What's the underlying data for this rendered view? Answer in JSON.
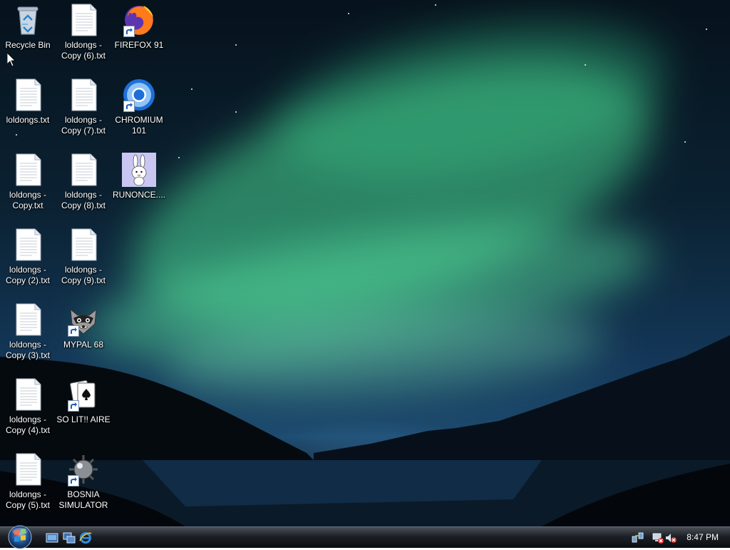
{
  "desktop": {
    "icons": [
      {
        "label": "Recycle Bin",
        "icon": "recycle-bin-icon"
      },
      {
        "label": "loldongs - Copy (6).txt",
        "icon": "text-file-icon"
      },
      {
        "label": "FIREFOX 91",
        "icon": "firefox-icon"
      },
      {
        "label": "loldongs.txt",
        "icon": "text-file-icon"
      },
      {
        "label": "loldongs - Copy (7).txt",
        "icon": "text-file-icon"
      },
      {
        "label": "CHROMIUM 101",
        "icon": "chromium-icon"
      },
      {
        "label": "loldongs - Copy.txt",
        "icon": "text-file-icon"
      },
      {
        "label": "loldongs - Copy (8).txt",
        "icon": "text-file-icon"
      },
      {
        "label": "RUNONCE....",
        "icon": "bunny-icon"
      },
      {
        "label": "loldongs - Copy (2).txt",
        "icon": "text-file-icon"
      },
      {
        "label": "loldongs - Copy (9).txt",
        "icon": "text-file-icon"
      },
      {
        "label": "loldongs - Copy (3).txt",
        "icon": "text-file-icon"
      },
      {
        "label": "MYPAL 68",
        "icon": "raccoon-icon"
      },
      {
        "label": "loldongs - Copy (4).txt",
        "icon": "text-file-icon"
      },
      {
        "label": "SO LIT!! AIRE",
        "icon": "solitaire-icon"
      },
      {
        "label": "loldongs - Copy (5).txt",
        "icon": "text-file-icon"
      },
      {
        "label": "BOSNIA SIMULATOR",
        "icon": "minesweeper-icon"
      }
    ]
  },
  "taskbar": {
    "start": "start-orb-icon",
    "quick_launch": [
      "show-desktop-icon",
      "switch-windows-icon",
      "internet-explorer-icon"
    ],
    "tray": [
      "network-icon",
      "network-disconnected-icon",
      "volume-muted-icon"
    ],
    "clock": "8:47 PM"
  },
  "colors": {
    "taskbar": "#1c2026",
    "aurora": "#46d28c",
    "label_text": "#ffffff"
  }
}
